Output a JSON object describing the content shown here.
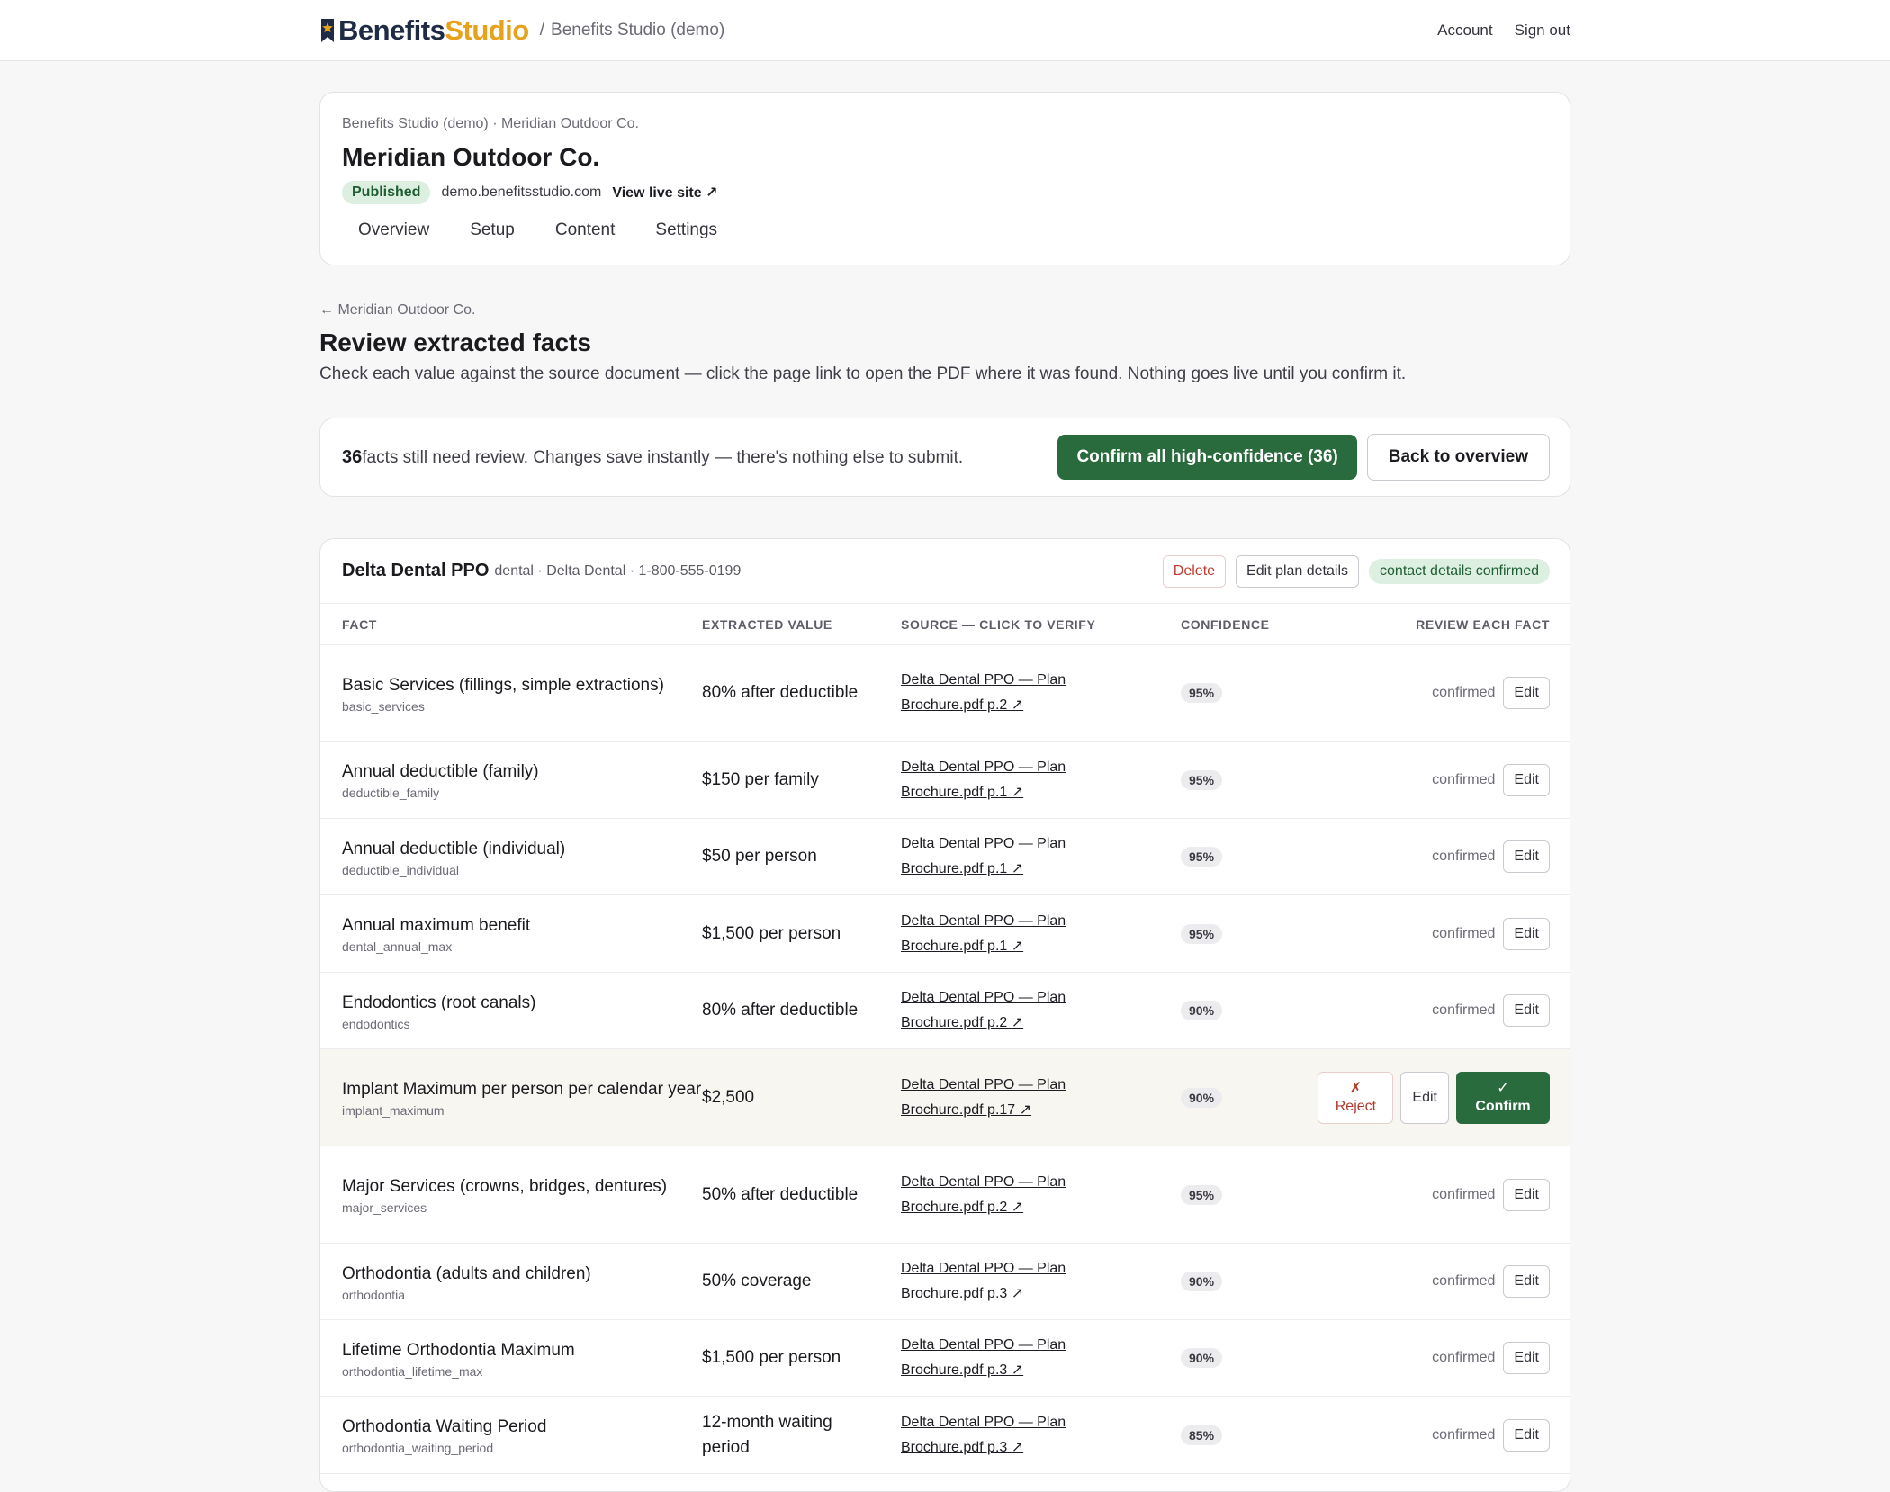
{
  "topbar": {
    "logo_part1": "Benefits",
    "logo_part2": "Studio",
    "breadcrumb_sep": "/",
    "breadcrumb": "Benefits Studio (demo)",
    "account": "Account",
    "sign_out": "Sign out"
  },
  "org": {
    "breadcrumb": "Benefits Studio (demo) · Meridian Outdoor Co.",
    "title": "Meridian Outdoor Co.",
    "status": "Published",
    "domain": "demo.benefitsstudio.com",
    "live_link": "View live site ↗",
    "tabs": [
      "Overview",
      "Setup",
      "Content",
      "Settings"
    ]
  },
  "page": {
    "back": "← Meridian Outdoor Co.",
    "title": "Review extracted facts",
    "subtitle": "Check each value against the source document — click the page link to open the PDF where it was found. Nothing goes live until you confirm it."
  },
  "review_bar": {
    "count": "36",
    "text": "facts still need review. Changes save instantly — there's nothing else to submit.",
    "confirm_all": "Confirm all high-confidence (36)",
    "back": "Back to overview"
  },
  "plan": {
    "name": "Delta Dental PPO",
    "meta": "dental · Delta Dental · 1-800-555-0199",
    "delete": "Delete",
    "edit_details": "Edit plan details",
    "contact_status": "contact details confirmed"
  },
  "table": {
    "headers": {
      "fact": "FACT",
      "value": "EXTRACTED VALUE",
      "source": "SOURCE — CLICK TO VERIFY",
      "confidence": "CONFIDENCE",
      "review": "REVIEW EACH FACT"
    },
    "rows": [
      {
        "label": "Basic Services (fillings, simple extractions)",
        "key": "basic_services",
        "value": "80% after deductible",
        "source_line1": "Delta Dental PPO — Plan",
        "source_line2": "Brochure.pdf p.2 ↗",
        "confidence": "95%",
        "status": "confirmed",
        "edit": "Edit"
      },
      {
        "label": "Annual deductible (family)",
        "key": "deductible_family",
        "value": "$150 per family",
        "source_line1": "Delta Dental PPO — Plan",
        "source_line2": "Brochure.pdf p.1 ↗",
        "confidence": "95%",
        "status": "confirmed",
        "edit": "Edit"
      },
      {
        "label": "Annual deductible (individual)",
        "key": "deductible_individual",
        "value": "$50 per person",
        "source_line1": "Delta Dental PPO — Plan",
        "source_line2": "Brochure.pdf p.1 ↗",
        "confidence": "95%",
        "status": "confirmed",
        "edit": "Edit"
      },
      {
        "label": "Annual maximum benefit",
        "key": "dental_annual_max",
        "value": "$1,500 per person",
        "source_line1": "Delta Dental PPO — Plan",
        "source_line2": "Brochure.pdf p.1 ↗",
        "confidence": "95%",
        "status": "confirmed",
        "edit": "Edit"
      },
      {
        "label": "Endodontics (root canals)",
        "key": "endodontics",
        "value": "80% after deductible",
        "source_line1": "Delta Dental PPO — Plan",
        "source_line2": "Brochure.pdf p.2 ↗",
        "confidence": "90%",
        "status": "confirmed",
        "edit": "Edit"
      },
      {
        "label": "Implant Maximum per person per calendar year",
        "key": "implant_maximum",
        "value": "$2,500",
        "source_line1": "Delta Dental PPO — Plan",
        "source_line2": "Brochure.pdf p.17 ↗",
        "confidence": "90%",
        "reject_icon": "✗",
        "reject": "Reject",
        "edit": "Edit",
        "confirm_icon": "✓",
        "confirm": "Confirm"
      },
      {
        "label": "Major Services (crowns, bridges, dentures)",
        "key": "major_services",
        "value": "50% after deductible",
        "source_line1": "Delta Dental PPO — Plan",
        "source_line2": "Brochure.pdf p.2 ↗",
        "confidence": "95%",
        "status": "confirmed",
        "edit": "Edit"
      },
      {
        "label": "Orthodontia (adults and children)",
        "key": "orthodontia",
        "value": "50% coverage",
        "source_line1": "Delta Dental PPO — Plan",
        "source_line2": "Brochure.pdf p.3 ↗",
        "confidence": "90%",
        "status": "confirmed",
        "edit": "Edit"
      },
      {
        "label": "Lifetime Orthodontia Maximum",
        "key": "orthodontia_lifetime_max",
        "value": "$1,500 per person",
        "source_line1": "Delta Dental PPO — Plan",
        "source_line2": "Brochure.pdf p.3 ↗",
        "confidence": "90%",
        "status": "confirmed",
        "edit": "Edit"
      },
      {
        "label": "Orthodontia Waiting Period",
        "key": "orthodontia_waiting_period",
        "value": "12-month waiting period",
        "source_line1": "Delta Dental PPO — Plan",
        "source_line2": "Brochure.pdf p.3 ↗",
        "confidence": "85%",
        "status": "confirmed",
        "edit": "Edit"
      }
    ]
  },
  "colors": {
    "primary_green": "#2a6b3e",
    "pill_green_bg": "#dcefe0",
    "logo_navy": "#1f2a44",
    "logo_gold": "#e8a11a",
    "danger": "#c0392b"
  }
}
